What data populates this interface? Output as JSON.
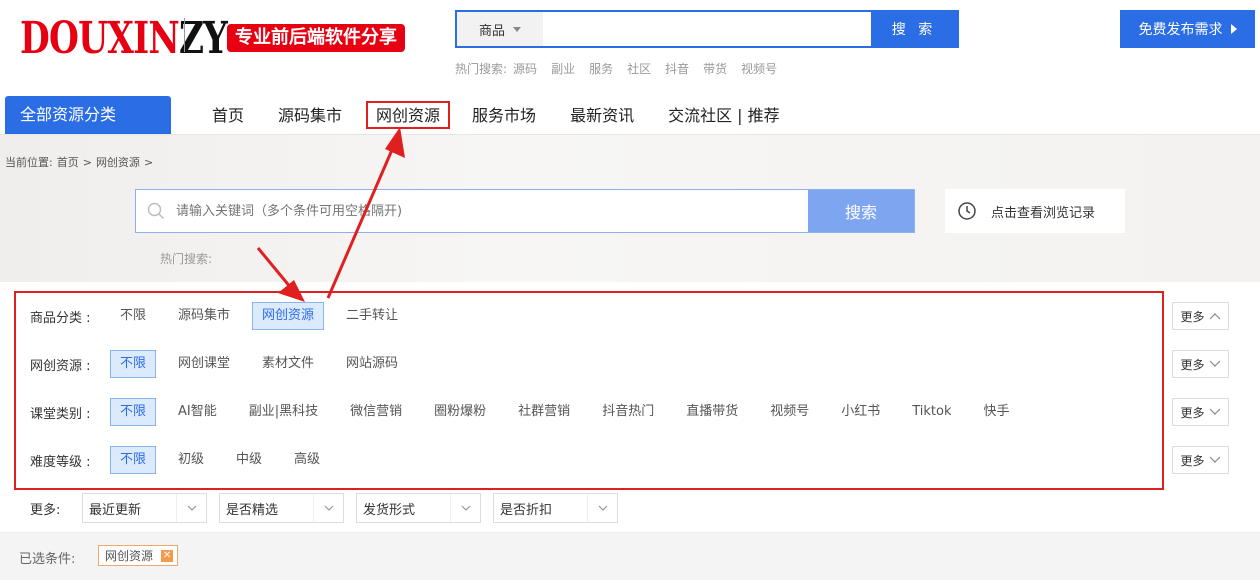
{
  "logo": {
    "part1": "DOUXIN",
    "part2": "ZY",
    "slogan": "专业前后端软件分享"
  },
  "top_search": {
    "category": "商品",
    "placeholder": "",
    "button": "搜 索"
  },
  "hot_top": {
    "label": "热门搜索:",
    "items": [
      "源码",
      "副业",
      "服务",
      "社区",
      "抖音",
      "带货",
      "视频号"
    ]
  },
  "publish": {
    "label": "免费发布需求"
  },
  "nav": {
    "all_categories": "全部资源分类",
    "items": [
      "首页",
      "源码集市",
      "网创资源",
      "服务市场",
      "最新资讯",
      "交流社区 | 推荐"
    ],
    "highlighted_index": 2
  },
  "breadcrumb": {
    "label": "当前位置:",
    "home": "首页",
    "sep": ">",
    "current": "网创资源"
  },
  "main_search": {
    "placeholder": "请输入关键词（多个条件可用空格隔开)",
    "button": "搜索"
  },
  "history": {
    "label": "点击查看浏览记录"
  },
  "hot_main": {
    "label": "热门搜索:"
  },
  "filters": [
    {
      "label": "商品分类 :",
      "options": [
        "不限",
        "源码集市",
        "网创资源",
        "二手转让"
      ],
      "selected": 2,
      "more": "更多"
    },
    {
      "label": "网创资源 :",
      "options": [
        "不限",
        "网创课堂",
        "素材文件",
        "网站源码"
      ],
      "selected": 0,
      "more": "更多"
    },
    {
      "label": "课堂类别 :",
      "options": [
        "不限",
        "AI智能",
        "副业|黑科技",
        "微信营销",
        "圈粉爆粉",
        "社群营销",
        "抖音热门",
        "直播带货",
        "视频号",
        "小红书",
        "Tiktok",
        "快手"
      ],
      "selected": 0,
      "more": "更多"
    },
    {
      "label": "难度等级 :",
      "options": [
        "不限",
        "初级",
        "中级",
        "高级"
      ],
      "selected": 0,
      "more": "更多"
    }
  ],
  "more_filters": {
    "label": "更多:",
    "dropdowns": [
      "最近更新",
      "是否精选",
      "发货形式",
      "是否折扣"
    ]
  },
  "selected_conditions": {
    "label": "已选条件:",
    "chips": [
      "网创资源"
    ]
  },
  "colors": {
    "primary": "#2b6de5",
    "highlight_red": "#e02020",
    "selected_bg": "#dceafd",
    "chip_orange": "#f39a4f"
  }
}
